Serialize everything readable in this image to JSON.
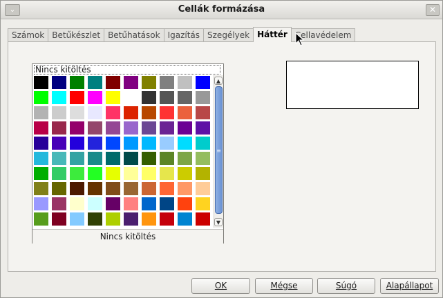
{
  "window": {
    "title": "Cellák formázása",
    "menu_glyph": "⌄",
    "close_glyph": "✕"
  },
  "tabs": [
    {
      "label": "Számok",
      "active": false
    },
    {
      "label": "Betűkészlet",
      "active": false
    },
    {
      "label": "Betűhatások",
      "active": false
    },
    {
      "label": "Igazítás",
      "active": false
    },
    {
      "label": "Szegélyek",
      "active": false
    },
    {
      "label": "Háttér",
      "active": true
    },
    {
      "label": "Cellavédelem",
      "active": false
    }
  ],
  "background": {
    "selected_field": "Nincs kitöltés",
    "list_label": "Nincs kitöltés",
    "colors": [
      [
        "#000000",
        "#000080",
        "#008000",
        "#008080",
        "#800000",
        "#800080",
        "#808000",
        "#808080",
        "#c0c0c0",
        "#0000ff"
      ],
      [
        "#00ff00",
        "#00ffff",
        "#ff0000",
        "#ff00ff",
        "#ffff00",
        "#ffffff",
        "#333333",
        "#555555",
        "#666666",
        "#999999"
      ],
      [
        "#b3b3b3",
        "#cccccc",
        "#dddddd",
        "#e8e8ff",
        "#ff3366",
        "#dc2300",
        "#b84700",
        "#ff3333",
        "#eb613d",
        "#b84747"
      ],
      [
        "#b80047",
        "#99284c",
        "#94006b",
        "#94476b",
        "#944794",
        "#9966cc",
        "#6b4794",
        "#6b2394",
        "#6b0094",
        "#5e11a6"
      ],
      [
        "#280099",
        "#4700b8",
        "#2300dc",
        "#2323dc",
        "#0047ff",
        "#0099ff",
        "#00b8ff",
        "#99ccff",
        "#00dcff",
        "#00cccc"
      ],
      [
        "#23b8dc",
        "#47b8b8",
        "#33a3a3",
        "#198a8a",
        "#006b6b",
        "#004a4a",
        "#355e00",
        "#5c8526",
        "#7da647",
        "#94bd5e"
      ],
      [
        "#00ae00",
        "#33cc66",
        "#3deb3d",
        "#23ff23",
        "#e6ff00",
        "#ffff99",
        "#ffff66",
        "#e6e64c",
        "#cccc00",
        "#b3b300"
      ],
      [
        "#808019",
        "#666600",
        "#4c1900",
        "#663300",
        "#804c19",
        "#996633",
        "#cc6633",
        "#ff6633",
        "#ff9966",
        "#ffcc99"
      ],
      [
        "#9999ff",
        "#993366",
        "#ffffcc",
        "#ccffff",
        "#660066",
        "#ff8080",
        "#0066cc",
        "#004586",
        "#ff420e",
        "#ffd320"
      ],
      [
        "#579d1c",
        "#7e0021",
        "#83caff",
        "#314004",
        "#aecf00",
        "#4b1f6f",
        "#ff950e",
        "#c5000b",
        "#0084d1",
        "#cc0000"
      ]
    ]
  },
  "scrollbar": {
    "up_glyph": "▲",
    "down_glyph": "▼",
    "grip_glyph": "≡"
  },
  "buttons": {
    "ok": "OK",
    "cancel": "Mégse",
    "help": "Súgó",
    "reset": "Alapállapot"
  }
}
